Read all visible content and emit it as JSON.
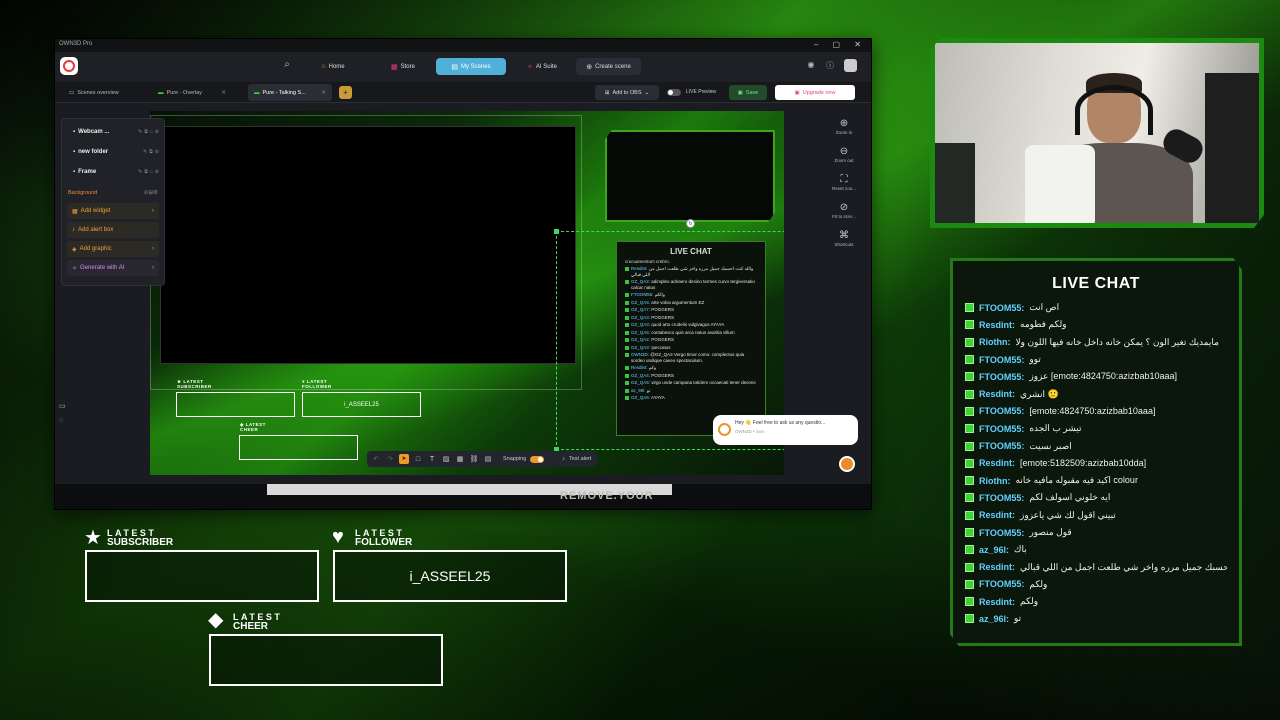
{
  "app": {
    "title": "OWN3D Pro",
    "nav": {
      "home": "Home",
      "store": "Store",
      "my_scenes": "My Scenes",
      "ai_suite": "AI Suite",
      "create_scene": "Create scene"
    },
    "tabs": {
      "overview": "Scenes overview",
      "pure_overlay": "Pure - Overlay",
      "pure_talking": "Pure - Talking S..."
    },
    "toolbar": {
      "add_to_obs": "Add to OBS",
      "live_preview": "LIVE Preview",
      "save": "Save",
      "upgrade": "Upgrade now"
    },
    "layers": [
      {
        "label": "Webcam ..."
      },
      {
        "label": "new folder"
      },
      {
        "label": "Frame"
      }
    ],
    "background_label": "Background",
    "actions": {
      "add_widget": "Add widget",
      "add_alert_box": "Add alert box",
      "add_graphic": "Add graphic",
      "generate_ai": "Generate with AI"
    },
    "right_tools": {
      "zoom_in": "Zoom in",
      "zoom_out": "Zoom out",
      "reset_zoom": "Reset zoo...",
      "fit_to_screen": "Fit to scre...",
      "shortcuts": "Shortcuts"
    },
    "bottom_toolbar": {
      "snapping": "Snapping",
      "test_alert": "Test alert"
    },
    "help_bubble": {
      "text": "Hey 👋 Feel free to ask us any questio...",
      "sub": "OWN3D • 2wo"
    },
    "bottom_strip_text": "REMOVE.YOUR",
    "scene_preview": {
      "chat_title": "LIVE CHAT",
      "chat_top": "crucuamentum crebro.",
      "chat_lines": [
        {
          "user": "Resdint:",
          "msg": "والله كنت احسبك جميل مرره واخر شي طلعت اجمل من اللي قبالي"
        },
        {
          "user": "GZ_QA2:",
          "msg": "adimpleo adnaero desino termes curvo tergiversatio calcar natus"
        },
        {
          "user": "FTOOM55:",
          "msg": "والكم"
        },
        {
          "user": "GZ_QA5:",
          "msg": "arte volva argumentum EZ"
        },
        {
          "user": "GZ_QA7:",
          "msg": "POGGERS"
        },
        {
          "user": "GZ_QA3:",
          "msg": "POGGERS"
        },
        {
          "user": "GZ_QA3:",
          "msg": "quod arto crudelis vulgivagus AYAYA"
        },
        {
          "user": "GZ_QA5:",
          "msg": "contabesco quis arca natus avaritia villum"
        },
        {
          "user": "GZ_QA2:",
          "msg": "POGGERS"
        },
        {
          "user": "GZ_QA3:",
          "msg": "!peccatus"
        },
        {
          "user": "OWN3D:",
          "msg": "@GZ_QA3 Vergo timor comu: complectus quia sordeo undique caveo spectaculum."
        },
        {
          "user": "Resdint:",
          "msg": "وكم"
        },
        {
          "user": "GZ_QA4:",
          "msg": "POGGERS"
        },
        {
          "user": "GZ_QA5:",
          "msg": "virgo unde campana totidem occaecati tener decens"
        },
        {
          "user": "az_96l:",
          "msg": "تو"
        },
        {
          "user": "GZ_QA6:",
          "msg": "AYAYA"
        }
      ],
      "latest_subscriber_l1": "LATEST",
      "latest_subscriber_l2": "SUBSCRIBER",
      "latest_follower_l1": "LATEST",
      "latest_follower_l2": "FOLLOWER",
      "latest_follower_value": "i_ASSEEL25",
      "latest_cheer_l1": "LATEST",
      "latest_cheer_l2": "CHEER"
    }
  },
  "overlay": {
    "chat_title": "LIVE CHAT",
    "chat": [
      {
        "user": "FTOOM55:",
        "msg": "اص انت"
      },
      {
        "user": "Resdint:",
        "msg": "ولكم فطومه"
      },
      {
        "user": "Riothn:",
        "msg": "مايمديك تغير الون ؟ يمكن خانه داخل خانه فيها اللون ولا"
      },
      {
        "user": "FTOOM55:",
        "msg": "توو"
      },
      {
        "user": "FTOOM55:",
        "msg": "عزوز [emote:4824750:azizbab10aaa]"
      },
      {
        "user": "Resdint:",
        "msg": "انشري 🙂"
      },
      {
        "user": "FTOOM55:",
        "msg": "[emote:4824750:azizbab10aaa]"
      },
      {
        "user": "FTOOM55:",
        "msg": "تيشر ب الجده"
      },
      {
        "user": "FTOOM55:",
        "msg": "اصبر نسيت"
      },
      {
        "user": "Resdint:",
        "msg": "[emote:5182509:azizbab10dda]"
      },
      {
        "user": "Riothn:",
        "msg": "اكيد فيه مقبوله مافيه خانه colour"
      },
      {
        "user": "FTOOM55:",
        "msg": "ايه خلوني اسولف لكم"
      },
      {
        "user": "Resdint:",
        "msg": "تبيني اقول لك شي ياعزوز"
      },
      {
        "user": "FTOOM55:",
        "msg": "قول منصور"
      },
      {
        "user": "az_96l:",
        "msg": "باك"
      },
      {
        "user": "Resdint:",
        "msg": "وقسم كنت احسبك جميل مرره واخر شي طلعت اجمل من اللي قبالي"
      },
      {
        "user": "FTOOM55:",
        "msg": "ولكم"
      },
      {
        "user": "Resdint:",
        "msg": "ولكم"
      },
      {
        "user": "az_96l:",
        "msg": "تو"
      }
    ],
    "latest": {
      "subscriber": {
        "l1": "LATEST",
        "l2": "SUBSCRIBER",
        "value": ""
      },
      "follower": {
        "l1": "LATEST",
        "l2": "FOLLOWER",
        "value": "i_ASSEEL25"
      },
      "cheer": {
        "l1": "LATEST",
        "l2": "CHEER",
        "value": ""
      }
    }
  },
  "icons": {
    "star": "star-icon",
    "heart": "heart-icon",
    "diamond": "diamond-icon",
    "chat_badge": "badge-icon"
  },
  "colors": {
    "accent_green": "#3ed13a",
    "username_blue": "#62d0ff",
    "nav_active": "#4fb1d8",
    "brand_orange": "#f08a2a"
  }
}
